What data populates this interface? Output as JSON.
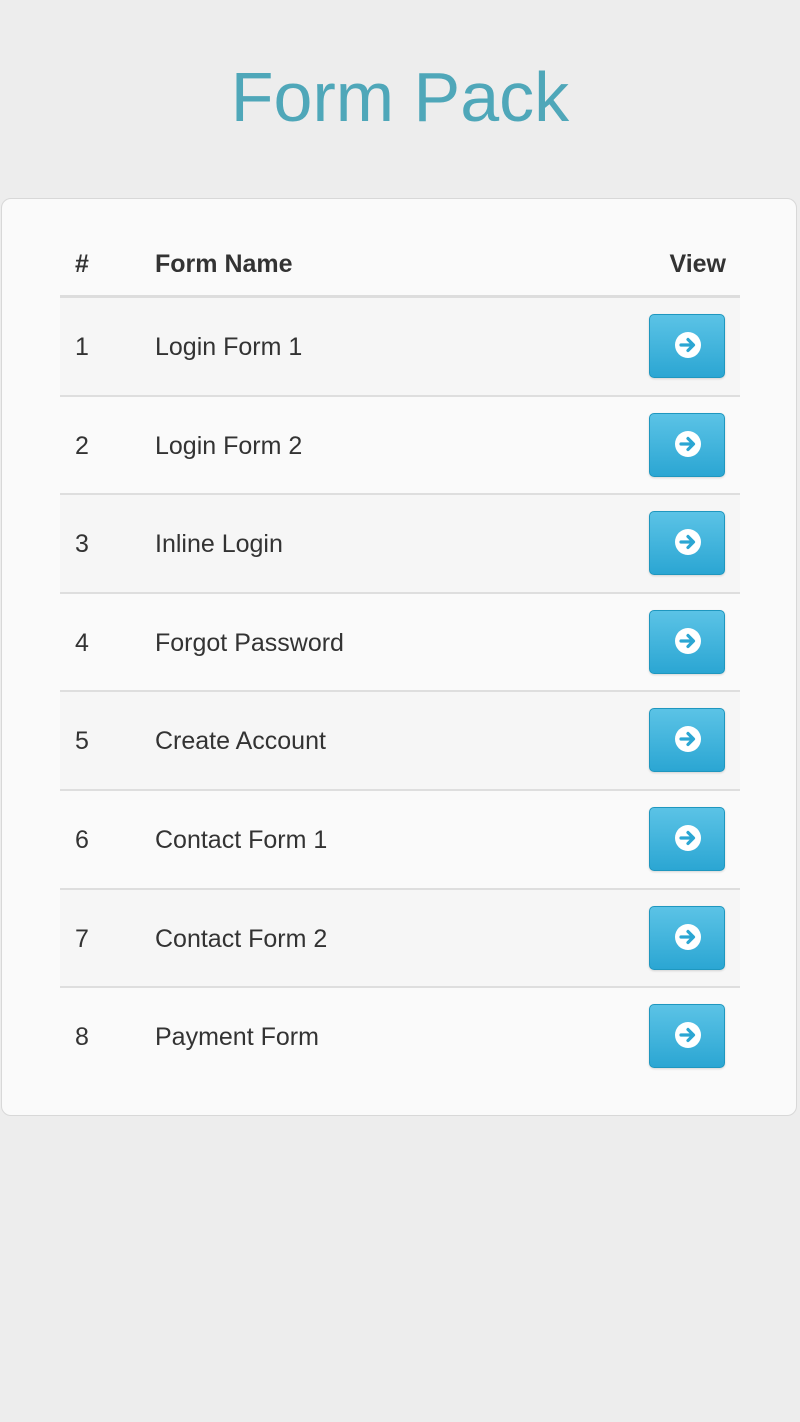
{
  "header": {
    "title": "Form Pack"
  },
  "table": {
    "columns": {
      "number": "#",
      "name": "Form Name",
      "view": "View"
    },
    "rows": [
      {
        "number": "1",
        "name": "Login Form 1"
      },
      {
        "number": "2",
        "name": "Login Form 2"
      },
      {
        "number": "3",
        "name": "Inline Login"
      },
      {
        "number": "4",
        "name": "Forgot Password"
      },
      {
        "number": "5",
        "name": "Create Account"
      },
      {
        "number": "6",
        "name": "Contact Form 1"
      },
      {
        "number": "7",
        "name": "Contact Form 2"
      },
      {
        "number": "8",
        "name": "Payment Form"
      }
    ],
    "view_icon": "arrow-circle-right-icon"
  },
  "colors": {
    "title": "#4fa7b9",
    "button": "#2ba6d3",
    "background": "#ededed"
  }
}
